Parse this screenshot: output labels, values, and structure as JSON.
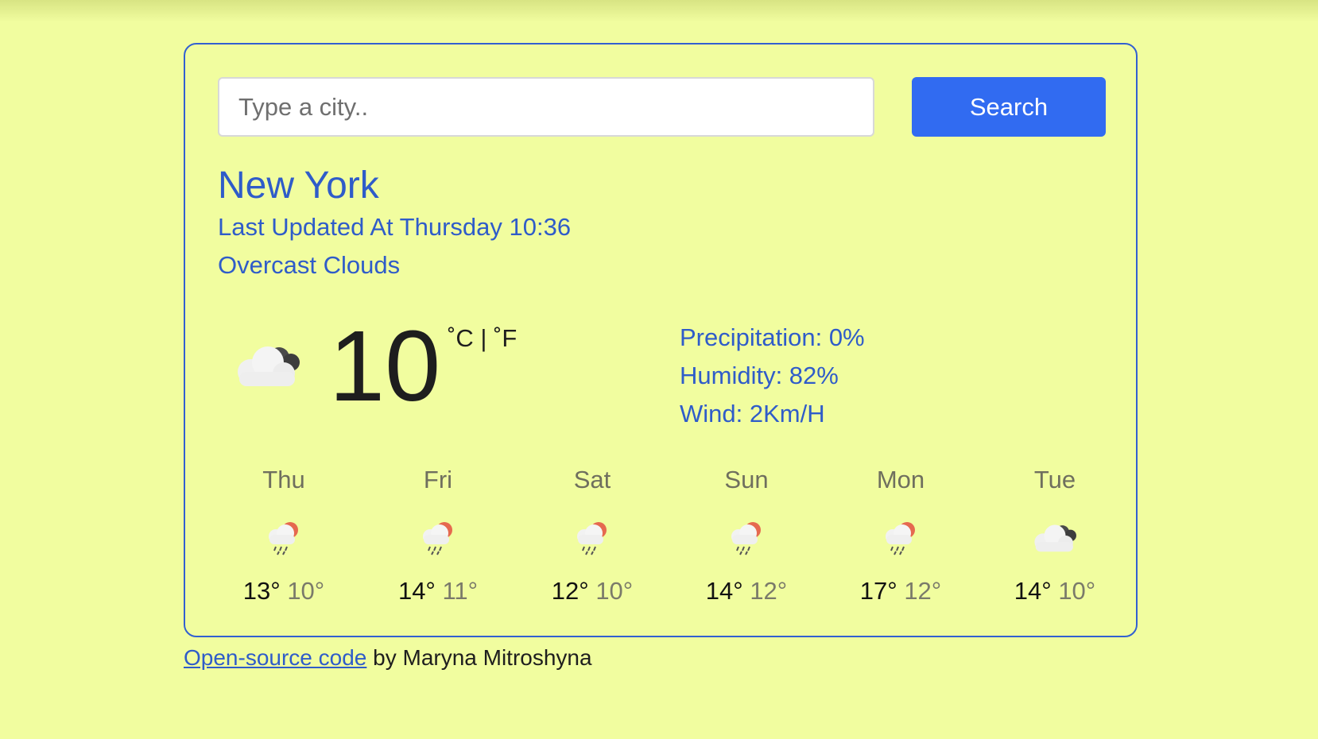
{
  "search": {
    "placeholder": "Type a city..",
    "button_label": "Search"
  },
  "current": {
    "city": "New York",
    "updated": "Last Updated At Thursday 10:36",
    "description": "Overcast Clouds",
    "icon": "overcast-clouds-icon",
    "temperature": "10",
    "unit_celsius": "˚C",
    "unit_separator": "|",
    "unit_fahrenheit": "˚F",
    "precipitation": "Precipitation: 0%",
    "humidity": "Humidity: 82%",
    "wind": "Wind: 2Km/H"
  },
  "forecast": [
    {
      "day": "Thu",
      "icon": "light-rain-icon",
      "max": "13°",
      "min": "10°"
    },
    {
      "day": "Fri",
      "icon": "light-rain-icon",
      "max": "14°",
      "min": "11°"
    },
    {
      "day": "Sat",
      "icon": "light-rain-icon",
      "max": "12°",
      "min": "10°"
    },
    {
      "day": "Sun",
      "icon": "light-rain-icon",
      "max": "14°",
      "min": "12°"
    },
    {
      "day": "Mon",
      "icon": "light-rain-icon",
      "max": "17°",
      "min": "12°"
    },
    {
      "day": "Tue",
      "icon": "overcast-clouds-icon",
      "max": "14°",
      "min": "10°"
    }
  ],
  "footer": {
    "link_text": "Open-source code",
    "rest": " by Maryna Mitroshyna"
  },
  "colors": {
    "background": "#f1fd9f",
    "accent": "#316bf1",
    "text_blue": "#2f5cc9"
  }
}
